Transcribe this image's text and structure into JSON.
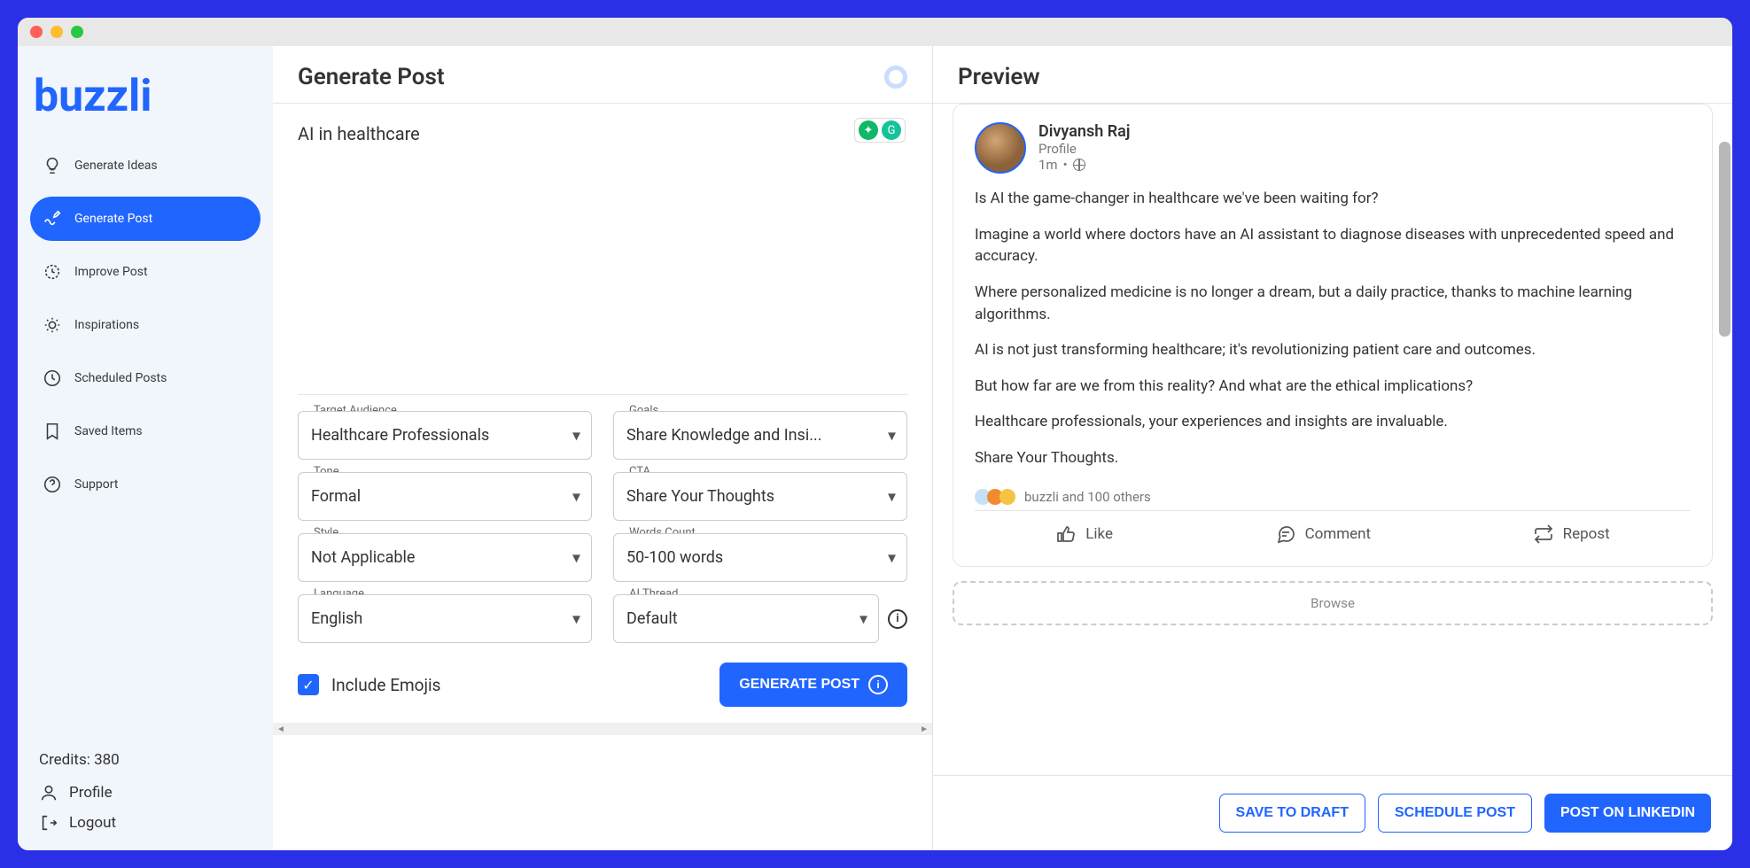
{
  "app_name": "buzzli",
  "sidebar": {
    "items": [
      {
        "label": "Generate Ideas",
        "active": false
      },
      {
        "label": "Generate Post",
        "active": true
      },
      {
        "label": "Improve Post",
        "active": false
      },
      {
        "label": "Inspirations",
        "active": false
      },
      {
        "label": "Scheduled Posts",
        "active": false
      },
      {
        "label": "Saved Items",
        "active": false
      },
      {
        "label": "Support",
        "active": false
      }
    ],
    "credits_label": "Credits: 380",
    "profile_label": "Profile",
    "logout_label": "Logout"
  },
  "generate": {
    "title": "Generate Post",
    "topic_value": "AI in healthcare",
    "fields": {
      "audience": {
        "label": "Target Audience",
        "value": "Healthcare Professionals"
      },
      "goals": {
        "label": "Goals",
        "value": "Share Knowledge and Insi..."
      },
      "tone": {
        "label": "Tone",
        "value": "Formal"
      },
      "cta": {
        "label": "CTA",
        "value": "Share Your Thoughts"
      },
      "style": {
        "label": "Style",
        "value": "Not Applicable"
      },
      "wordcount": {
        "label": "Words Count",
        "value": "50-100 words"
      },
      "language": {
        "label": "Language",
        "value": "English"
      },
      "thread": {
        "label": "AI Thread",
        "value": "Default"
      }
    },
    "include_emojis_label": "Include Emojis",
    "include_emojis_checked": true,
    "submit_label": "GENERATE POST"
  },
  "preview": {
    "title": "Preview",
    "author_name": "Divyansh Raj",
    "author_subtitle": "Profile",
    "author_time": "1m",
    "body_paragraphs": [
      "Is AI the game-changer in healthcare we've been waiting for?",
      "Imagine a world where doctors have an AI assistant to diagnose diseases with unprecedented speed and accuracy.",
      "Where personalized medicine is no longer a dream, but a daily practice, thanks to machine learning algorithms.",
      "AI is not just transforming healthcare; it's revolutionizing patient care and outcomes.",
      "But how far are we from this reality? And what are the ethical implications?",
      "Healthcare professionals, your experiences and insights are invaluable.",
      "Share Your  Thoughts."
    ],
    "reactions_text": "buzzli and 100 others",
    "actions": {
      "like": "Like",
      "comment": "Comment",
      "repost": "Repost"
    },
    "browse_label": "Browse",
    "buttons": {
      "save_draft": "SAVE TO DRAFT",
      "schedule": "SCHEDULE POST",
      "post": "POST ON LINKEDIN"
    }
  }
}
